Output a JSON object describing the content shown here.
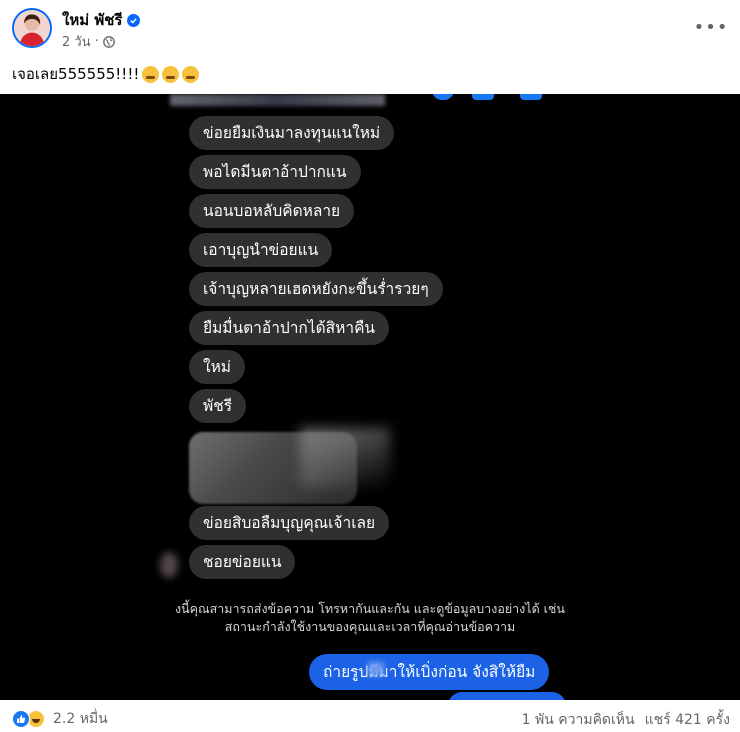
{
  "post": {
    "author": "ใหม่ พัชรี",
    "time": "2 วัน",
    "separator": "·",
    "caption": "เจอเลย555555!!!!",
    "caption_emojis": [
      "grin-sweat-emoji",
      "tired-face-emoji",
      "squint-tongue-emoji"
    ],
    "more_label": "•••"
  },
  "screenshot": {
    "received_messages": [
      "ข่อยยืมเงินมาลงทุนแนใหม่",
      "พอไดมีนตาอ้าปากแน",
      "นอนบอหลับคิดหลาย",
      "เอาบุญนำข่อยแน",
      "เจ้าบุญหลายเฮดหยังกะขึ้นร่ำรวยๆ",
      "ยืมมื่นตาอ้าปากได้สิหาคืน",
      "ใหม่",
      "พัชรี",
      "ข่อยสิบอลืมบุญคุณเจ้าเลย",
      "ชอยข่อยแน"
    ],
    "notice_line1": "งนี้คุณสามารถส่งข้อความ โทรหากันและกัน และดูข้อมูลบางอย่างได้ เช่น",
    "notice_line2": "สถานะกำลังใช้งานของคุณและเวลาที่คุณอ่านข้อความ",
    "sent_message": "ถ่ายรูปมีมาให้เบิ่งก่อน จังสิให้ยืม"
  },
  "footer": {
    "reaction_count": "2.2 หมื่น",
    "comments": "1 พัน ความคิดเห็น",
    "shares": "แชร์ 421 ครั้ง"
  },
  "colors": {
    "brand_blue": "#0866ff",
    "bubble_gray": "#303030",
    "sent_blue": "#1b62e6"
  }
}
